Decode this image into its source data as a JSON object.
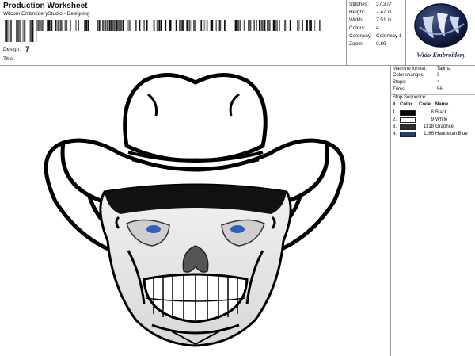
{
  "header": {
    "title": "Production Worksheet",
    "subtitle": "Wilcom EmbroideryStudio - Designing",
    "design_label": "Design:",
    "design_value": "7",
    "title_label": "Title:"
  },
  "stats": [
    {
      "label": "Stitches:",
      "value": "37,377"
    },
    {
      "label": "Height:",
      "value": "7.47 in"
    },
    {
      "label": "Width:",
      "value": "7.51 in"
    },
    {
      "label": "Colors:",
      "value": "4"
    },
    {
      "label": "Colorway:",
      "value": "Colorway 1"
    },
    {
      "label": "Zoom:",
      "value": "0.89"
    }
  ],
  "logo": {
    "text": "Wido Embroidery"
  },
  "machine": [
    {
      "label": "Machine format:",
      "value": "Tajima"
    },
    {
      "label": "Color changes:",
      "value": "3"
    },
    {
      "label": "Stops:",
      "value": "4"
    },
    {
      "label": "Trims:",
      "value": "56"
    }
  ],
  "stop_sequence": {
    "title": "Stop Sequence:",
    "headers": {
      "num": "#",
      "color": "Color",
      "code": "Code",
      "name": "Name"
    },
    "rows": [
      {
        "num": "1.",
        "swatch": "#000000",
        "code": "8",
        "name": "Black"
      },
      {
        "num": "2.",
        "swatch": "#ffffff",
        "code": "9",
        "name": "White"
      },
      {
        "num": "3.",
        "swatch": "#2b2d33",
        "code": "1318",
        "name": "Graphite"
      },
      {
        "num": "4.",
        "swatch": "#1f3f7a",
        "code": "1166",
        "name": "Hanukkah Blue"
      }
    ]
  },
  "colors": {
    "rule": "#999999",
    "eye_blue": "#2f5fb8",
    "logo_dark": "#1b2a55",
    "logo_light": "#cfd6e8"
  },
  "artwork": {
    "icon": "cowboy-skull-design"
  }
}
